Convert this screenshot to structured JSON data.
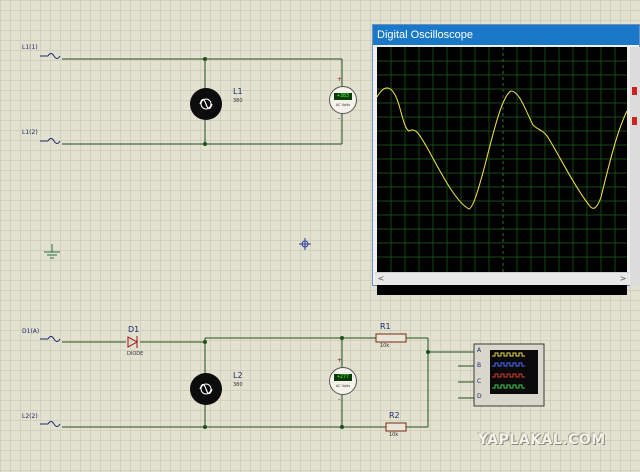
{
  "circuit_top": {
    "terminal_1": "L1(1)",
    "terminal_2": "L1(2)",
    "lamp_name": "L1",
    "lamp_value": "380",
    "meter_reading": "+383",
    "meter_unit": "AC Volts",
    "meter_plus": "+",
    "meter_minus": "-"
  },
  "circuit_bottom": {
    "terminal_1": "D1(A)",
    "terminal_2": "L2(2)",
    "diode_name": "D1",
    "diode_value": "DIODE",
    "lamp_name": "L2",
    "lamp_value": "380",
    "meter_reading": "+277",
    "meter_unit": "AC Volts",
    "meter_plus": "+",
    "meter_minus": "-",
    "r1_name": "R1",
    "r1_value": "10k",
    "r2_name": "R2",
    "r2_value": "10k",
    "scope_channels": [
      "A",
      "B",
      "C",
      "D"
    ]
  },
  "oscilloscope": {
    "title": "Digital Oscilloscope",
    "scroll_left": "<",
    "scroll_right": ">"
  },
  "watermark": "YAPLAKAL.COM",
  "colors": {
    "wire": "#1f4f1f",
    "grid_bg": "#e3e1cf",
    "scope_bg": "#000000",
    "scope_grid": "#1f5f1f",
    "trace": "#e6d84a",
    "title_bar": "#1979c8"
  }
}
